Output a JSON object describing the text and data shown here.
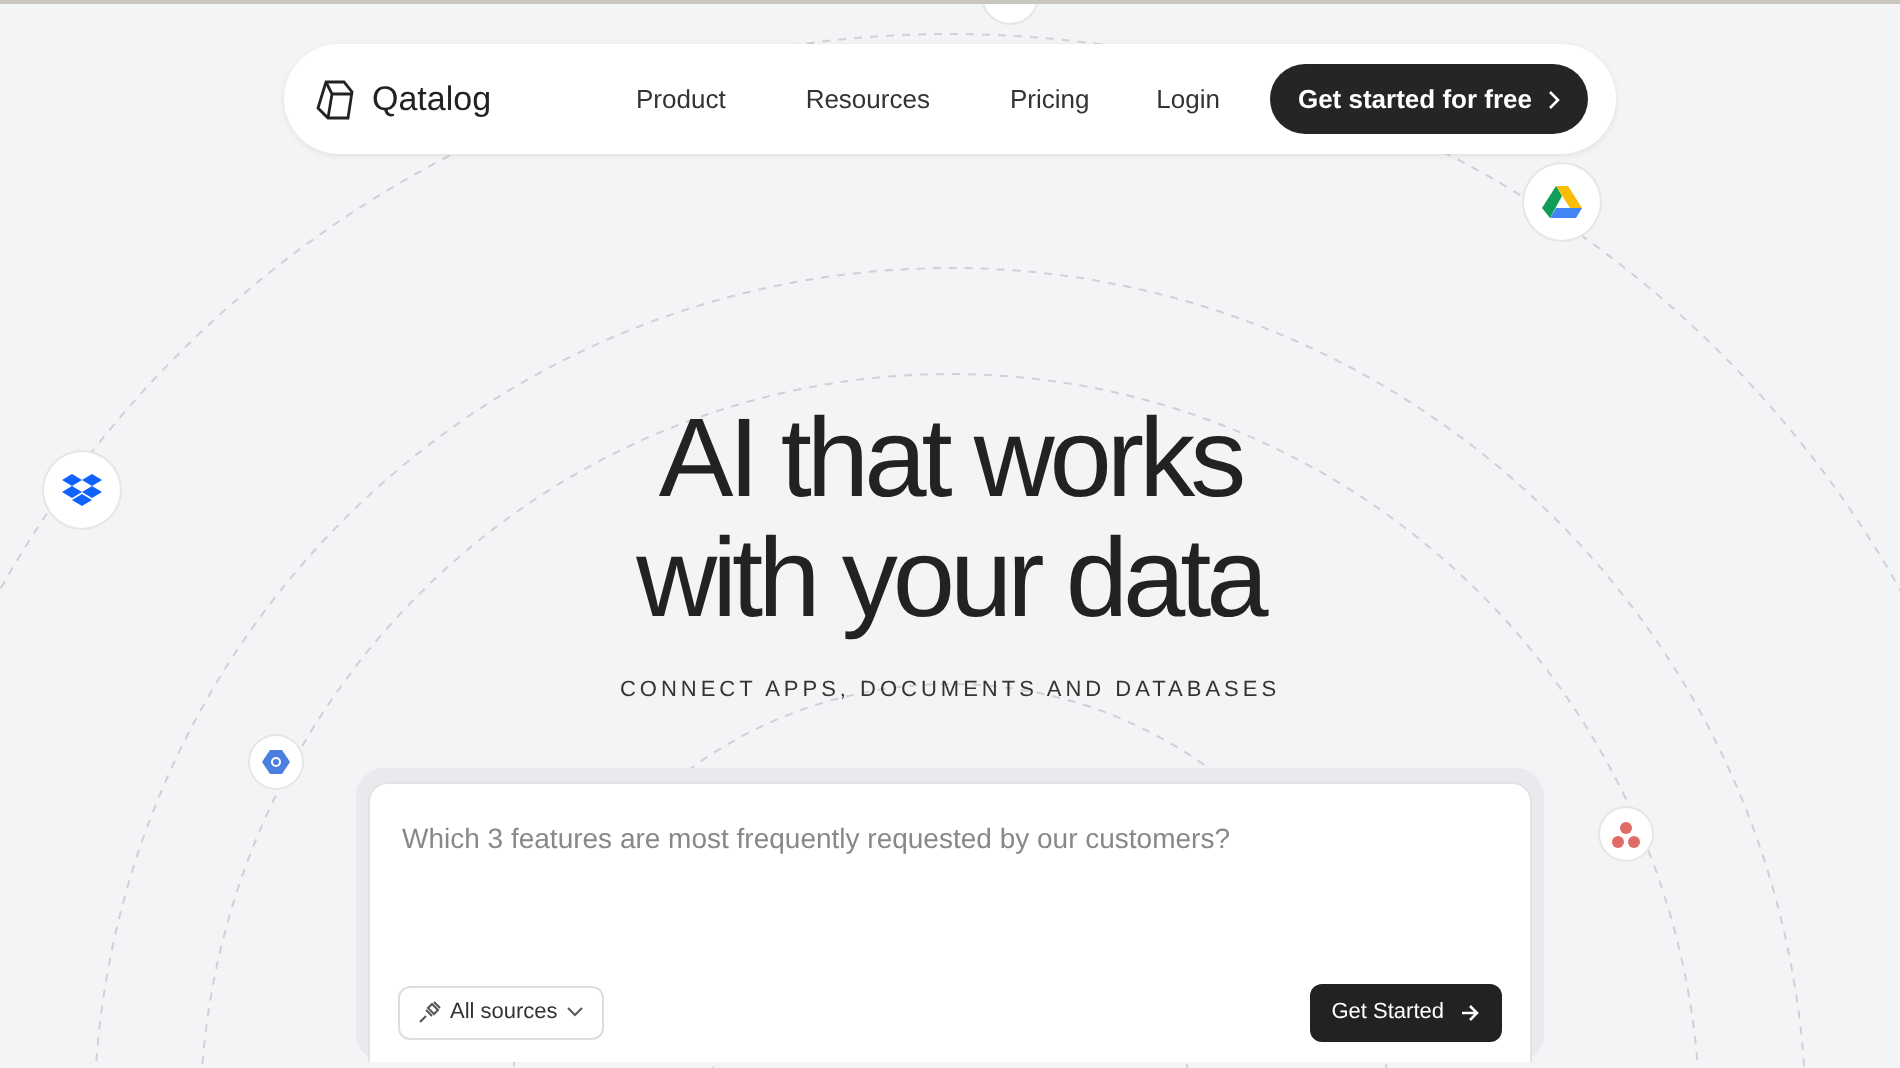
{
  "nav": {
    "brand": "Qatalog",
    "links": [
      {
        "label": "Product"
      },
      {
        "label": "Resources"
      },
      {
        "label": "Pricing"
      }
    ],
    "login": "Login",
    "cta": "Get started for free"
  },
  "hero": {
    "title_lines": [
      "AI that works",
      "with your data"
    ],
    "subtitle": "CONNECT APPS, DOCUMENTS AND DATABASES"
  },
  "prompt": {
    "placeholder": "Which 3 features are most frequently requested by our customers?",
    "sources": "All sources",
    "submit": "Get Started"
  },
  "integrations": [
    {
      "kind": "drive"
    },
    {
      "kind": "dropbox"
    },
    {
      "kind": "cloud"
    },
    {
      "kind": "asana"
    }
  ]
}
